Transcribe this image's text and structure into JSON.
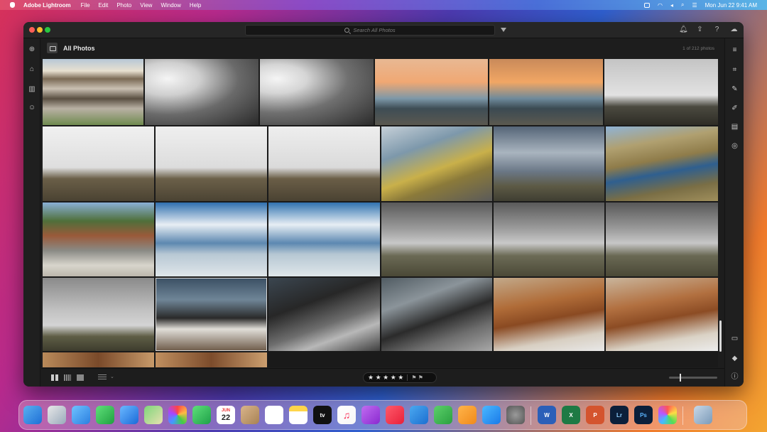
{
  "menubar": {
    "app_name": "Adobe Lightroom",
    "menus": [
      "File",
      "Edit",
      "Photo",
      "View",
      "Window",
      "Help"
    ],
    "datetime": "Mon Jun 22  9:41 AM"
  },
  "toolbar": {
    "search_placeholder": "Search All Photos"
  },
  "header": {
    "title": "All Photos",
    "count": "1 of 212 photos"
  },
  "rating_bar": {
    "stars": "★ ★ ★ ★ ★",
    "flags": "⚑ ⚑"
  },
  "dock": {
    "calendar_month": "JUN",
    "calendar_day": "22",
    "apps": [
      "Finder",
      "Launchpad",
      "Safari",
      "Messages",
      "Mail",
      "Maps",
      "Photos",
      "FaceTime",
      "Calendar",
      "Contacts",
      "Reminders",
      "Notes",
      "TV",
      "Music",
      "Podcasts",
      "News",
      "Keynote",
      "Numbers",
      "Pages",
      "App Store",
      "System Preferences",
      "Word",
      "Excel",
      "PowerPoint",
      "Lightroom",
      "Photoshop",
      "Color",
      "Finder Files"
    ],
    "word_label": "W",
    "excel_label": "X",
    "ppt_label": "P",
    "lr_label": "Lr",
    "ps_label": "Ps",
    "tv_label": "tv"
  },
  "photos": [
    {
      "name": "penguin-colony"
    },
    {
      "name": "water-drop-bw-1"
    },
    {
      "name": "water-drop-bw-2"
    },
    {
      "name": "sunset-sea-1"
    },
    {
      "name": "sunset-sea-2"
    },
    {
      "name": "mountain-bird"
    },
    {
      "name": "mountain-birds-1"
    },
    {
      "name": "mountain-birds-2"
    },
    {
      "name": "mountain-birds-3"
    },
    {
      "name": "rocky-coast"
    },
    {
      "name": "wind-turbines"
    },
    {
      "name": "river-aerial"
    },
    {
      "name": "barn-sheep"
    },
    {
      "name": "boat-lake-1"
    },
    {
      "name": "boat-lake-2"
    },
    {
      "name": "green-hut-1"
    },
    {
      "name": "green-hut-2"
    },
    {
      "name": "green-hut-3"
    },
    {
      "name": "green-hut-4"
    },
    {
      "name": "penguins-rocks"
    },
    {
      "name": "penguins-waves-1"
    },
    {
      "name": "penguins-waves-2"
    },
    {
      "name": "penguins-cliff-1"
    },
    {
      "name": "penguins-cliff-2"
    }
  ]
}
